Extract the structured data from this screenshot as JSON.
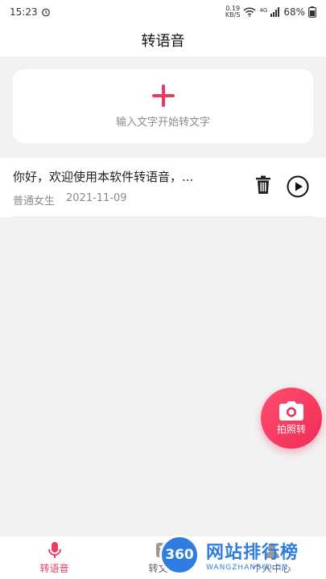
{
  "status_bar": {
    "time": "15:23",
    "net_speed_value": "0.19",
    "net_speed_unit": "KB/S",
    "network_type": "4G",
    "battery": "68%"
  },
  "header": {
    "title": "转语音"
  },
  "input_card": {
    "hint": "输入文字开始转文字"
  },
  "records": [
    {
      "text": "你好，欢迎使用本软件转语音，...",
      "voice": "普通女生",
      "date": "2021-11-09"
    }
  ],
  "fab": {
    "label": "拍照转"
  },
  "bottom_nav": {
    "items": [
      {
        "label": "转语音",
        "icon": "microphone-icon",
        "active": true
      },
      {
        "label": "转文字",
        "icon": "text-icon",
        "active": false
      },
      {
        "label": "个人中心",
        "icon": "person-icon",
        "active": false
      }
    ]
  },
  "watermark": {
    "logo_text": "360",
    "title": "网站排行榜",
    "subtitle": "WANGZHANB60.CN"
  },
  "colors": {
    "accent": "#ec3a63",
    "background": "#f2f2f2",
    "watermark_blue": "#2f7de1"
  }
}
